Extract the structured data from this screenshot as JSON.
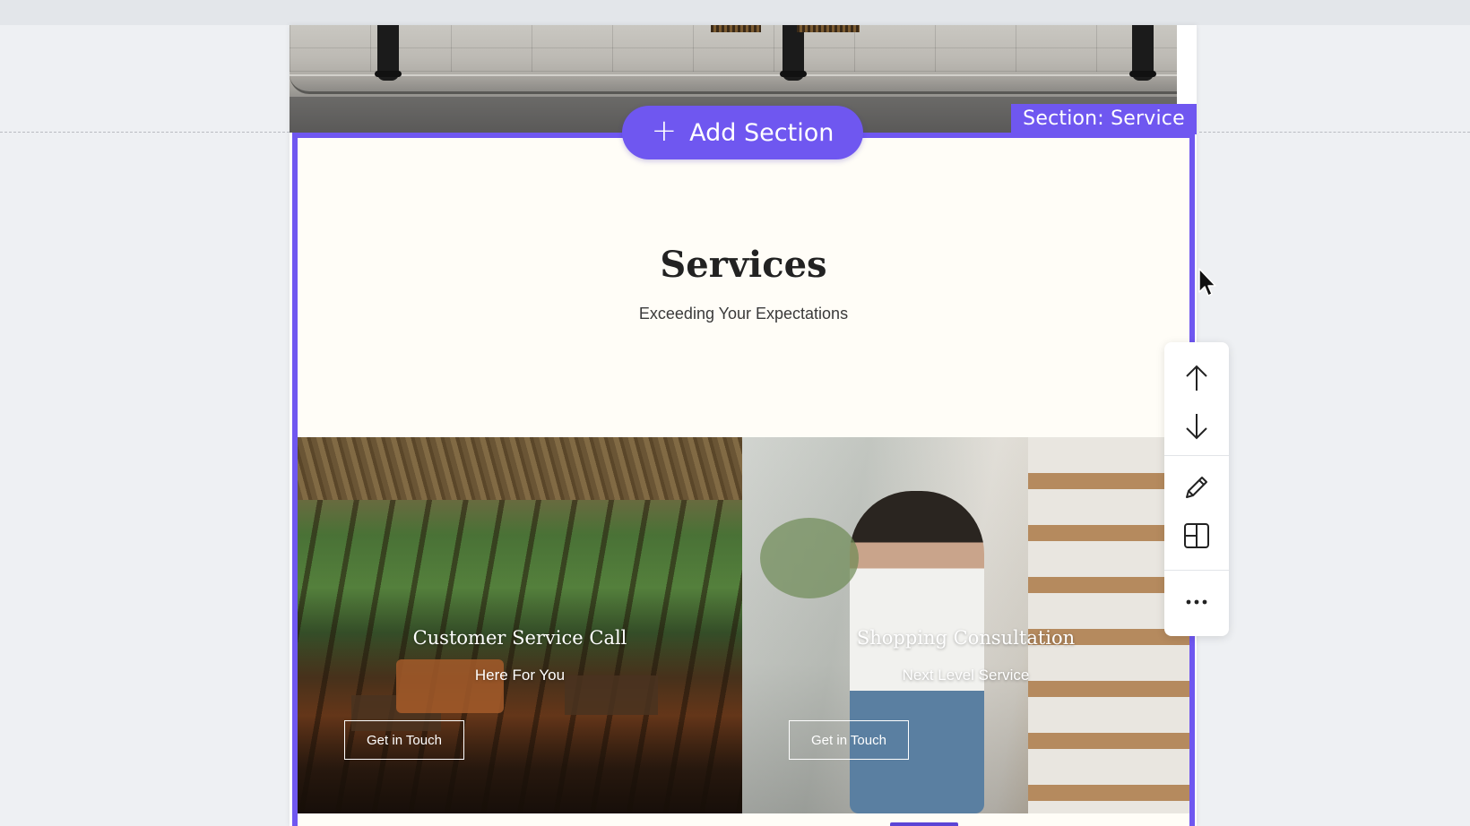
{
  "editor": {
    "section_tag": "Section: Service",
    "add_section_label": "Add Section",
    "add_section_icon": "plus-icon",
    "accent_color": "#6f57f0"
  },
  "services": {
    "title": "Services",
    "subtitle": "Exceeding Your Expectations",
    "cards": [
      {
        "title": "Customer Service Call",
        "subtitle": "Here For You",
        "button": "Get in Touch"
      },
      {
        "title": "Shopping Consultation",
        "subtitle": "Next Level Service",
        "button": "Get in Touch"
      }
    ]
  },
  "toolbar": {
    "items": [
      "arrow-up-icon",
      "arrow-down-icon",
      "pencil-icon",
      "layout-icon",
      "more-icon"
    ]
  }
}
